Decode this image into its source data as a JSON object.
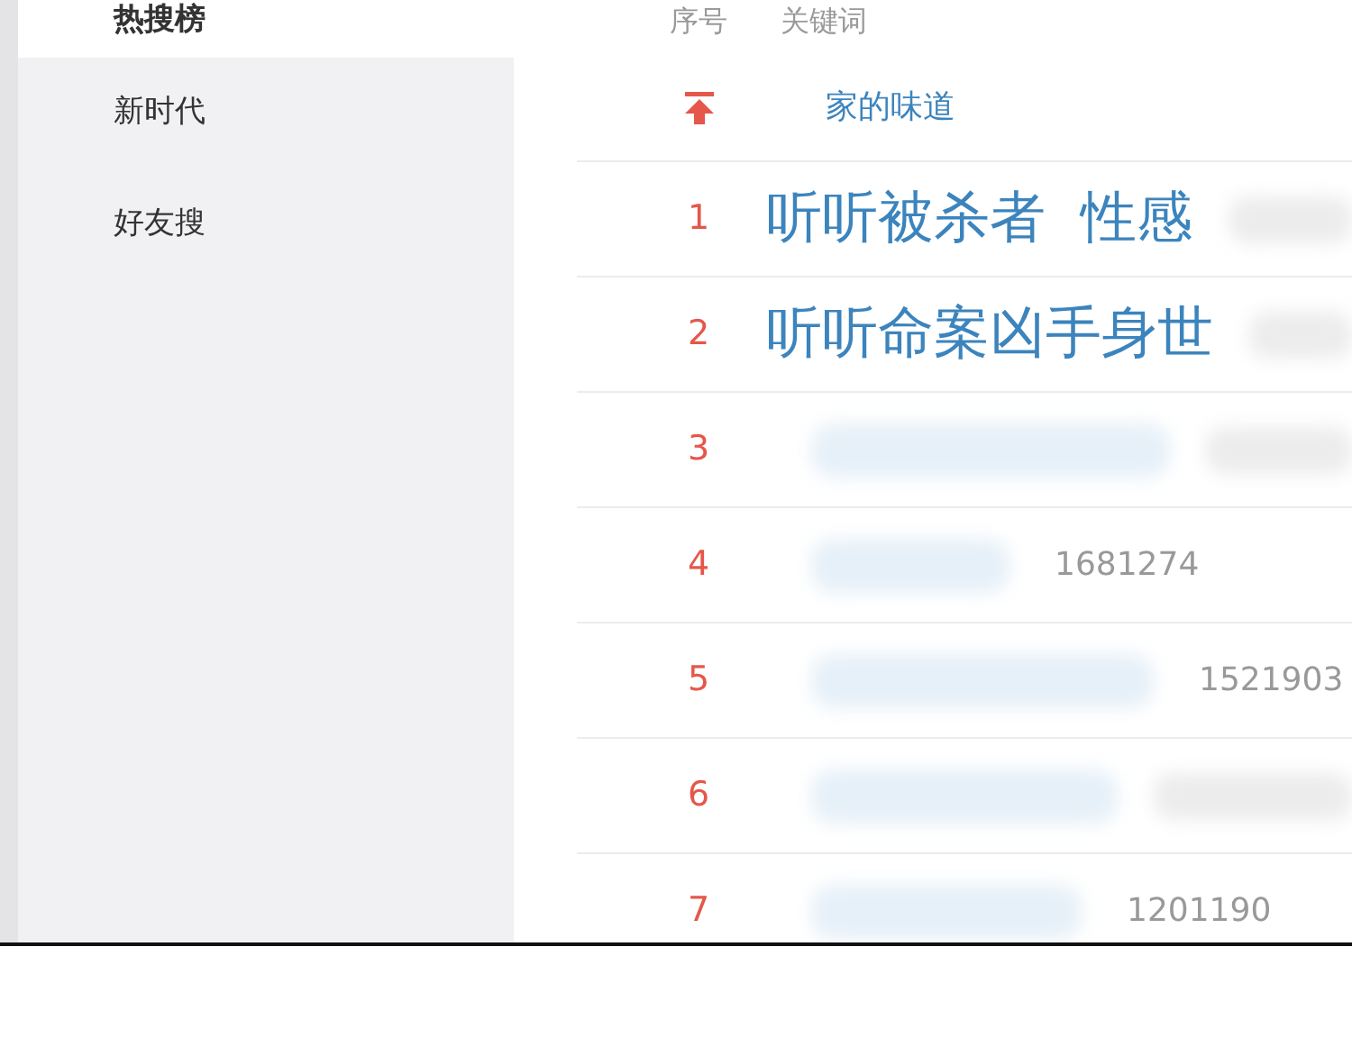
{
  "sidebar": {
    "items": [
      {
        "label": "热搜榜",
        "selected": true
      },
      {
        "label": "新时代",
        "selected": false
      },
      {
        "label": "好友搜",
        "selected": false
      }
    ]
  },
  "table": {
    "columns": [
      "序号",
      "关键词"
    ],
    "rows": [
      {
        "kind": "pinned",
        "keyword": "家的味道"
      },
      {
        "kind": "caption",
        "rank": "1",
        "keyword": "听听被杀者  性感",
        "count_blurred": true
      },
      {
        "kind": "caption",
        "rank": "2",
        "keyword": "听听命案凶手身世",
        "count_blurred": true
      },
      {
        "kind": "plain",
        "rank": "3",
        "keyword_blurred": true,
        "count_blurred": true
      },
      {
        "kind": "plain",
        "rank": "4",
        "keyword_blurred": true,
        "count": "1681274"
      },
      {
        "kind": "plain",
        "rank": "5",
        "keyword_blurred": true,
        "count": "1521903"
      },
      {
        "kind": "plain",
        "rank": "6",
        "keyword_blurred": true,
        "count_blurred": true
      },
      {
        "kind": "plain",
        "rank": "7",
        "keyword_blurred": true,
        "count": "1201190"
      }
    ]
  }
}
